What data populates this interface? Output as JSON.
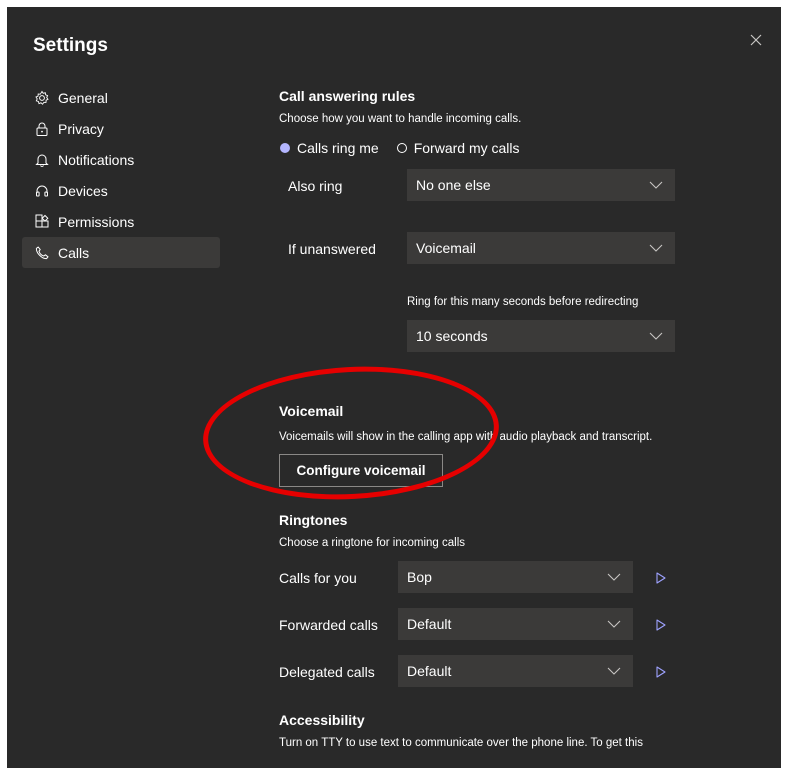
{
  "dialog": {
    "title": "Settings"
  },
  "sidebar": {
    "items": [
      {
        "label": "General",
        "icon": "gear-icon"
      },
      {
        "label": "Privacy",
        "icon": "lock-icon"
      },
      {
        "label": "Notifications",
        "icon": "bell-icon"
      },
      {
        "label": "Devices",
        "icon": "headset-icon"
      },
      {
        "label": "Permissions",
        "icon": "apps-icon"
      },
      {
        "label": "Calls",
        "icon": "phone-icon",
        "active": true
      }
    ]
  },
  "call_answering": {
    "heading": "Call answering rules",
    "description": "Choose how you want to handle incoming calls.",
    "options": [
      {
        "label": "Calls ring me",
        "selected": true
      },
      {
        "label": "Forward my calls",
        "selected": false
      }
    ],
    "also_ring": {
      "label": "Also ring",
      "value": "No one else"
    },
    "if_unanswered": {
      "label": "If unanswered",
      "value": "Voicemail"
    },
    "ring_seconds": {
      "label": "Ring for this many seconds before redirecting",
      "value": "10 seconds"
    }
  },
  "voicemail": {
    "heading": "Voicemail",
    "description": "Voicemails will show in the calling app with audio playback and transcript.",
    "button_label": "Configure voicemail"
  },
  "ringtones": {
    "heading": "Ringtones",
    "description": "Choose a ringtone for incoming calls",
    "rows": [
      {
        "label": "Calls for you",
        "value": "Bop"
      },
      {
        "label": "Forwarded calls",
        "value": "Default"
      },
      {
        "label": "Delegated calls",
        "value": "Default"
      }
    ]
  },
  "accessibility": {
    "heading": "Accessibility",
    "description": "Turn on TTY to use text to communicate over the phone line. To get this"
  },
  "colors": {
    "background": "#292929",
    "sidebar_active": "#3b3a39",
    "dropdown": "#3b3a39",
    "accent_radio": "#b4b6ff",
    "highlight_ellipse": "#e60000"
  }
}
